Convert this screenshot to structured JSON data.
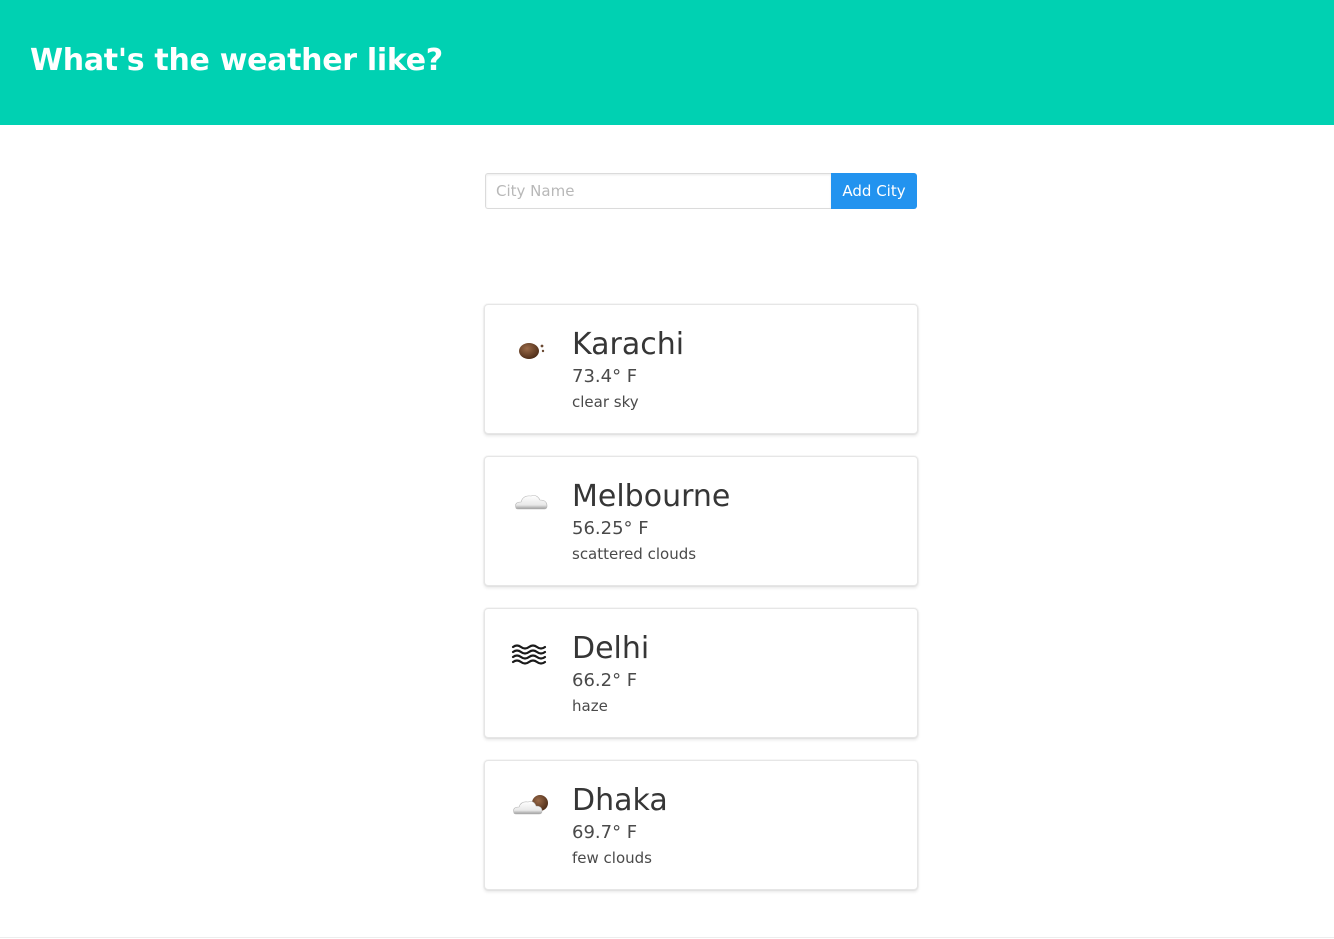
{
  "header": {
    "title": "What's the weather like?"
  },
  "search": {
    "placeholder": "City Name",
    "value": "",
    "button_label": "Add City"
  },
  "colors": {
    "hero_bg": "#00d1b2",
    "button_bg": "#2293ef"
  },
  "cities": [
    {
      "name": "Karachi",
      "temp": "73.4° F",
      "description": "clear sky",
      "icon": "clear-night-moon-icon"
    },
    {
      "name": "Melbourne",
      "temp": "56.25° F",
      "description": "scattered clouds",
      "icon": "cloud-icon"
    },
    {
      "name": "Delhi",
      "temp": "66.2° F",
      "description": "haze",
      "icon": "haze-icon"
    },
    {
      "name": "Dhaka",
      "temp": "69.7° F",
      "description": "few clouds",
      "icon": "cloud-moon-icon"
    }
  ]
}
